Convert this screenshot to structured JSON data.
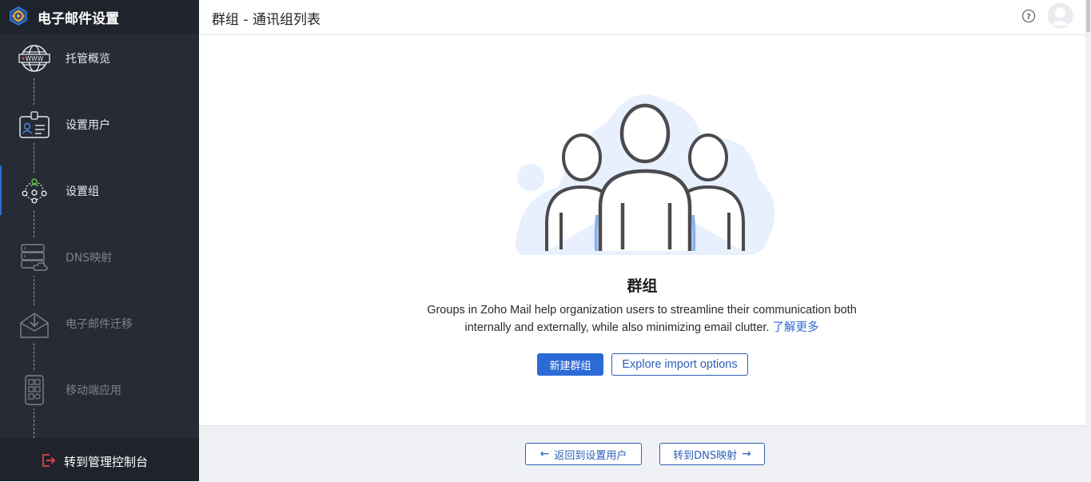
{
  "app": {
    "title": "电子邮件设置"
  },
  "header": {
    "title": "群组 - 通讯组列表"
  },
  "sidebar": {
    "steps": [
      {
        "label": "托管概览",
        "icon": "globe-www-icon",
        "state": "done"
      },
      {
        "label": "设置用户",
        "icon": "id-card-icon",
        "state": "done"
      },
      {
        "label": "设置组",
        "icon": "group-network-icon",
        "state": "active"
      },
      {
        "label": "DNS映射",
        "icon": "server-cloud-icon",
        "state": "disabled"
      },
      {
        "label": "电子邮件迁移",
        "icon": "mail-download-icon",
        "state": "disabled"
      },
      {
        "label": "移动端应用",
        "icon": "mobile-app-icon",
        "state": "disabled"
      }
    ],
    "admin_console": "转到管理控制台"
  },
  "main": {
    "title": "群组",
    "description": "Groups in Zoho Mail help organization users to streamline their communication both internally and externally, while also minimizing email clutter.",
    "learn_more": "了解更多",
    "new_group_button": "新建群组",
    "import_button": "Explore import options"
  },
  "footer": {
    "back_button": "返回到设置用户",
    "next_button": "转到DNS映射"
  },
  "colors": {
    "sidebar_bg": "#272b35",
    "accent": "#2c6ad6",
    "admin_icon": "#e04343"
  }
}
